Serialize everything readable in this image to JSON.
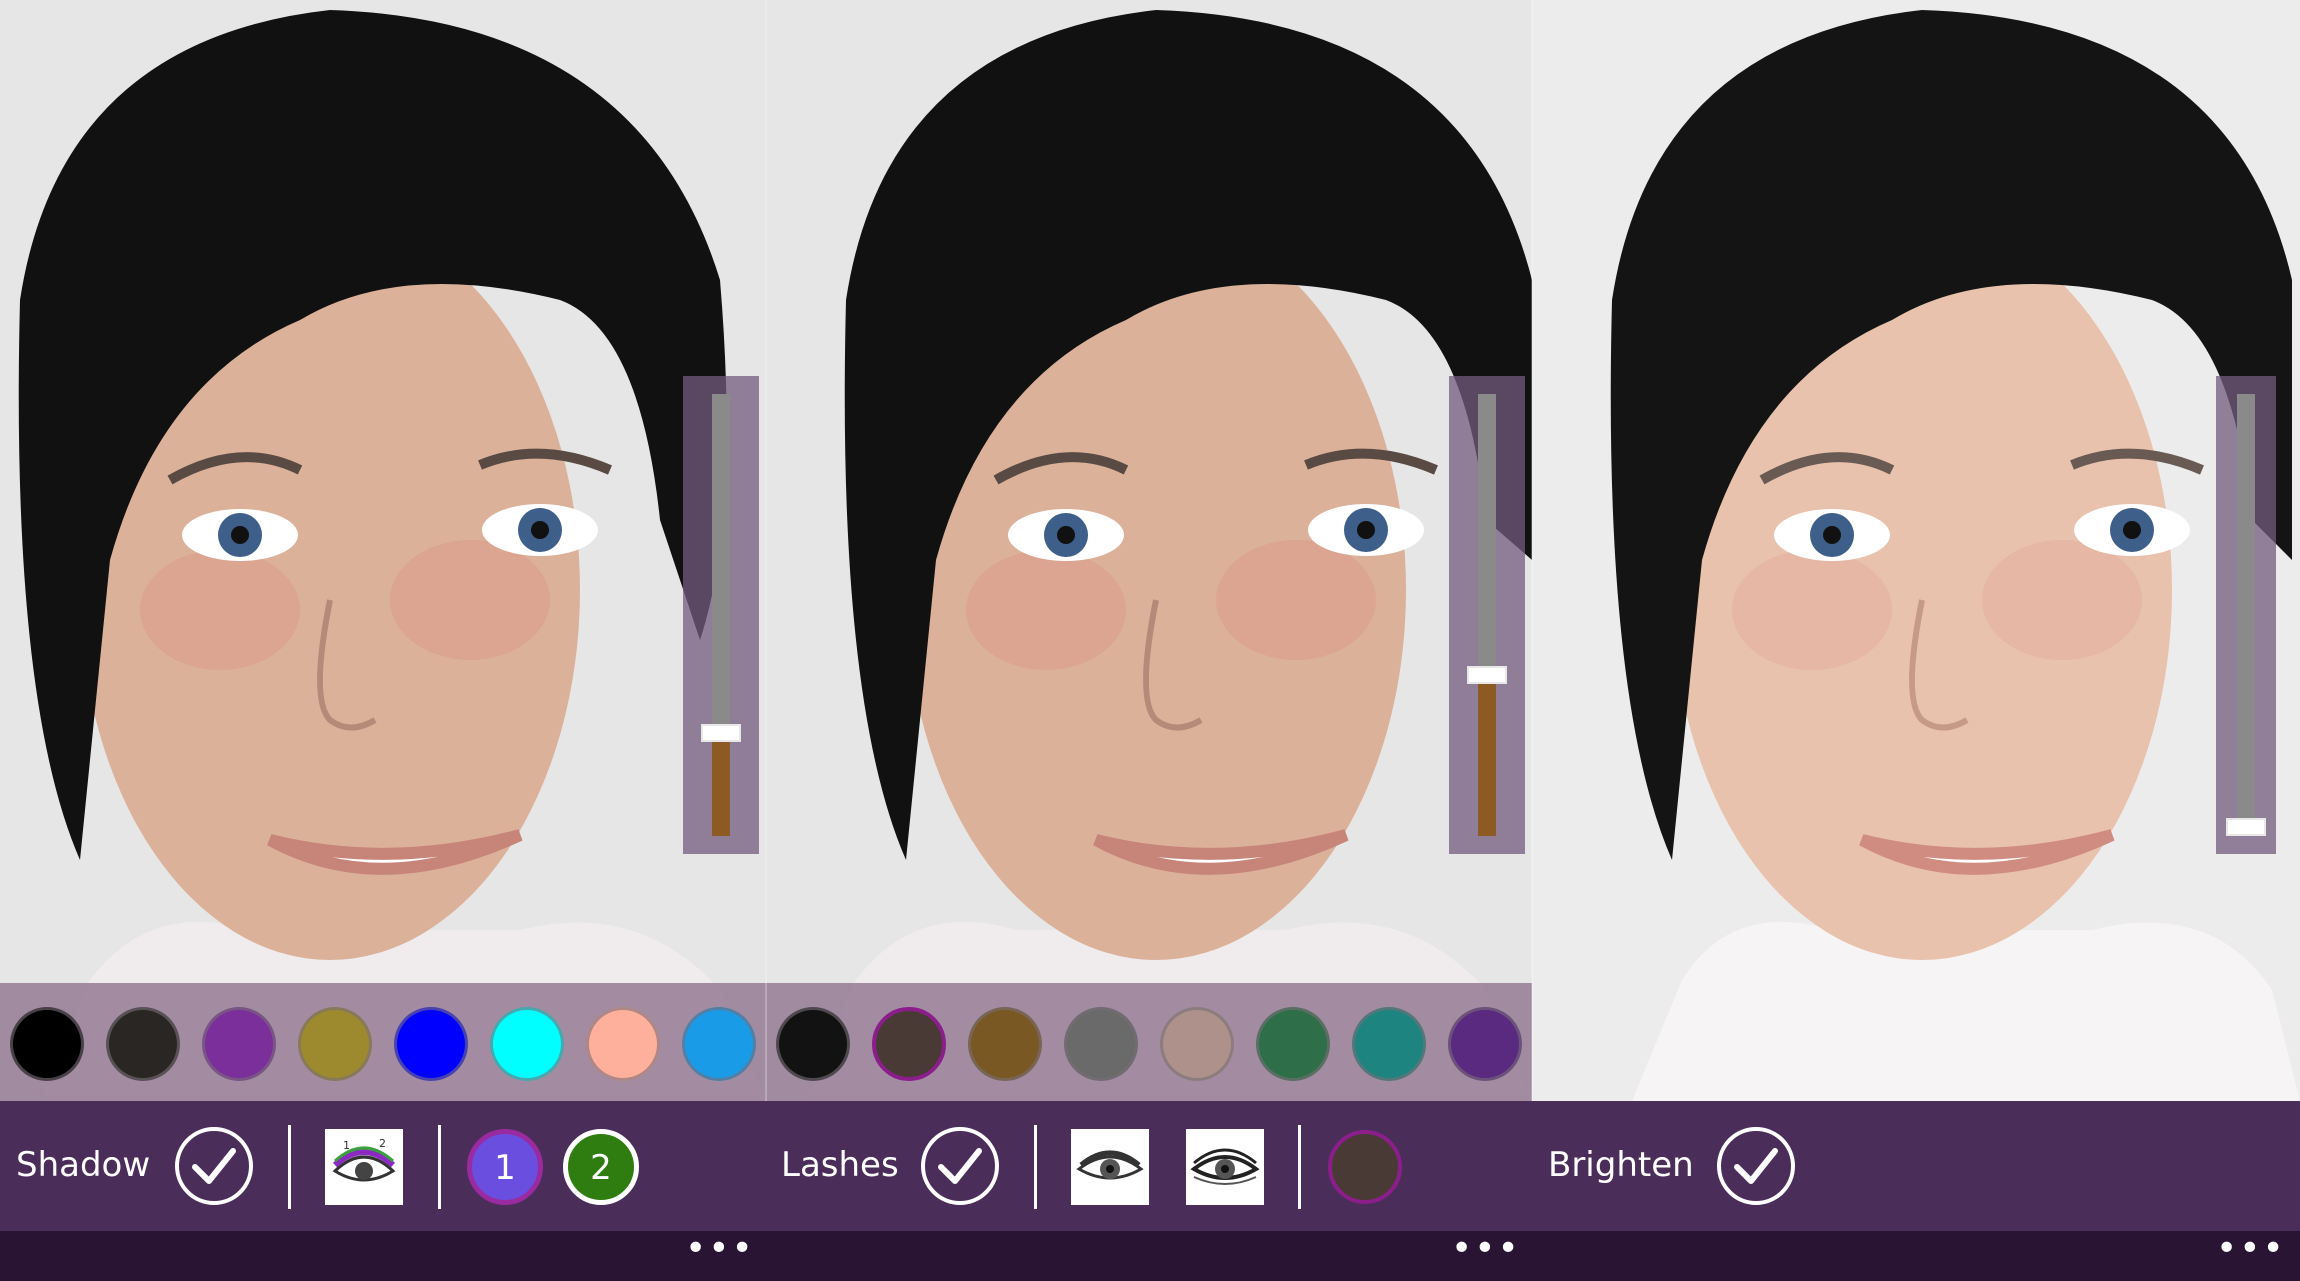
{
  "panels": [
    {
      "label": "Shadow",
      "slider_level": 0.22,
      "swatches": [
        {
          "color": "#000000",
          "selected": false
        },
        {
          "color": "#2a2624",
          "selected": false
        },
        {
          "color": "#7a2f9a",
          "selected": false
        },
        {
          "color": "#9e8a2e",
          "selected": false
        },
        {
          "color": "#0000ff",
          "selected": false
        },
        {
          "color": "#00ffff",
          "selected": false
        },
        {
          "color": "#ffb09c",
          "selected": false
        },
        {
          "color": "#1a9be8",
          "selected": false
        }
      ],
      "tool_icon": "eyeshadow-zones-icon",
      "zone_buttons": [
        {
          "label": "1",
          "color": "#6a4ee0",
          "border": "#9a2aa0"
        },
        {
          "label": "2",
          "color": "#2f7d10",
          "border": "#ffffff"
        }
      ]
    },
    {
      "label": "Lashes",
      "slider_level": 0.35,
      "swatches": [
        {
          "color": "#121212",
          "selected": false
        },
        {
          "color": "#4a3a36",
          "selected": true
        },
        {
          "color": "#7a5824",
          "selected": false
        },
        {
          "color": "#6a6a6a",
          "selected": false
        },
        {
          "color": "#ad918a",
          "selected": false
        },
        {
          "color": "#2e6e48",
          "selected": false
        },
        {
          "color": "#1e8480",
          "selected": false
        },
        {
          "color": "#5a2a80",
          "selected": false
        }
      ],
      "tool_icons": [
        "eye-lashes-natural-icon",
        "eye-lashes-bold-icon"
      ],
      "selected_color": "#4a3a36"
    },
    {
      "label": "Brighten",
      "slider_level": 0.0
    }
  ],
  "app_bar": {
    "more_label": "•••"
  }
}
